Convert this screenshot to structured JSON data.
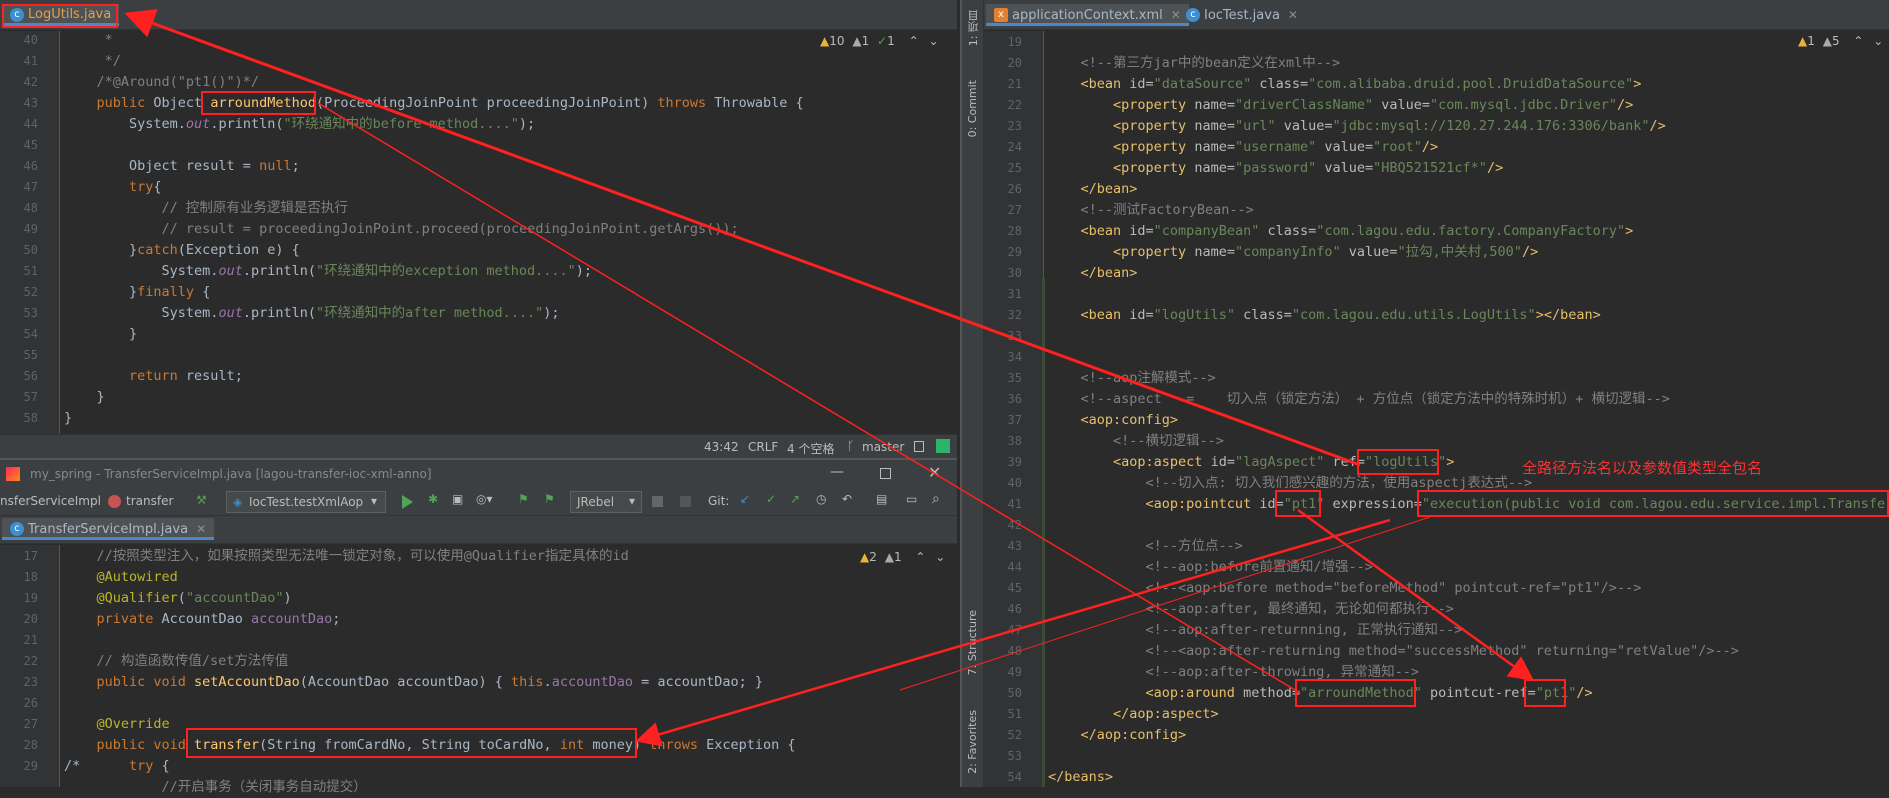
{
  "left_top": {
    "tab_label": "LogUtils.java",
    "inspection": {
      "warnings": "10",
      "weak": "1",
      "ok": "1"
    },
    "lines": [
      {
        "n": "40",
        "t": [
          [
            "cm",
            "     *"
          ]
        ]
      },
      {
        "n": "41",
        "t": [
          [
            "cm",
            "     */"
          ]
        ]
      },
      {
        "n": "42",
        "t": [
          [
            "cm",
            "    /*@Around(\"pt1()\")*/"
          ]
        ]
      },
      {
        "n": "43",
        "t": [
          [
            "kw",
            "    public "
          ],
          [
            "plain",
            "Object "
          ],
          [
            "fn",
            "arroundMethod"
          ],
          [
            "plain",
            "(ProceedingJoinPoint proceedingJoinPoint) "
          ],
          [
            "kw",
            "throws "
          ],
          [
            "plain",
            "Throwable {"
          ]
        ]
      },
      {
        "n": "44",
        "t": [
          [
            "plain",
            "        System."
          ],
          [
            "it",
            "out"
          ],
          [
            "plain",
            ".println("
          ],
          [
            "str",
            "\"环绕通知中的before method....\""
          ],
          [
            "plain",
            ");"
          ]
        ]
      },
      {
        "n": "45",
        "t": [
          [
            "plain",
            ""
          ]
        ]
      },
      {
        "n": "46",
        "t": [
          [
            "plain",
            "        Object result = "
          ],
          [
            "kw",
            "null"
          ],
          [
            "plain",
            ";"
          ]
        ]
      },
      {
        "n": "47",
        "t": [
          [
            "kw",
            "        try"
          ],
          [
            "plain",
            "{"
          ]
        ]
      },
      {
        "n": "48",
        "t": [
          [
            "cm",
            "            // 控制原有业务逻辑是否执行"
          ]
        ]
      },
      {
        "n": "49",
        "t": [
          [
            "cm",
            "            // result = proceedingJoinPoint.proceed(proceedingJoinPoint.getArgs());"
          ]
        ]
      },
      {
        "n": "50",
        "t": [
          [
            "plain",
            "        }"
          ],
          [
            "kw",
            "catch"
          ],
          [
            "plain",
            "(Exception e) {"
          ]
        ]
      },
      {
        "n": "51",
        "t": [
          [
            "plain",
            "            System."
          ],
          [
            "it",
            "out"
          ],
          [
            "plain",
            ".println("
          ],
          [
            "str",
            "\"环绕通知中的exception method....\""
          ],
          [
            "plain",
            ");"
          ]
        ]
      },
      {
        "n": "52",
        "t": [
          [
            "plain",
            "        }"
          ],
          [
            "kw",
            "finally "
          ],
          [
            "plain",
            "{"
          ]
        ]
      },
      {
        "n": "53",
        "t": [
          [
            "plain",
            "            System."
          ],
          [
            "it",
            "out"
          ],
          [
            "plain",
            ".println("
          ],
          [
            "str",
            "\"环绕通知中的after method....\""
          ],
          [
            "plain",
            ");"
          ]
        ]
      },
      {
        "n": "54",
        "t": [
          [
            "plain",
            "        }"
          ]
        ]
      },
      {
        "n": "55",
        "t": [
          [
            "plain",
            ""
          ]
        ]
      },
      {
        "n": "56",
        "t": [
          [
            "kw",
            "        return "
          ],
          [
            "plain",
            "result;"
          ]
        ]
      },
      {
        "n": "57",
        "t": [
          [
            "plain",
            "    }"
          ]
        ]
      },
      {
        "n": "58",
        "t": [
          [
            "plain",
            "}"
          ]
        ]
      }
    ],
    "status": {
      "pos": "43:42",
      "eol": "CRLF",
      "indent": "4 个空格",
      "branch": "master"
    }
  },
  "left_bottom": {
    "window_title": "my_spring - TransferServiceImpl.java [lagou-transfer-ioc-xml-anno]",
    "nav_class": "nsferServiceImpl",
    "nav_method": "transfer",
    "run_config": "IocTest.testXmlAop",
    "jrebel": "JRebel",
    "git_label": "Git:",
    "tab_label": "TransferServiceImpl.java",
    "inspection": {
      "warnings": "2",
      "weak": "1"
    },
    "lines": [
      {
        "n": "17",
        "t": [
          [
            "cm",
            "    //按照类型注入，如果按照类型无法唯一锁定对象，可以使用@Qualifier指定具体的id"
          ]
        ]
      },
      {
        "n": "18",
        "t": [
          [
            "an",
            "    @Autowired"
          ]
        ]
      },
      {
        "n": "19",
        "t": [
          [
            "an",
            "    @Qualifier"
          ],
          [
            "plain",
            "("
          ],
          [
            "str",
            "\"accountDao\""
          ],
          [
            "plain",
            ")"
          ]
        ]
      },
      {
        "n": "20",
        "t": [
          [
            "kw",
            "    private "
          ],
          [
            "plain",
            "AccountDao "
          ],
          [
            "fld",
            "accountDao"
          ],
          [
            "plain",
            ";"
          ]
        ]
      },
      {
        "n": "21",
        "t": [
          [
            "plain",
            ""
          ]
        ]
      },
      {
        "n": "22",
        "t": [
          [
            "cm",
            "    // 构造函数传值/set方法传值"
          ]
        ]
      },
      {
        "n": "23",
        "t": [
          [
            "kw",
            "    public void "
          ],
          [
            "fn",
            "setAccountDao"
          ],
          [
            "plain",
            "(AccountDao accountDao) { "
          ],
          [
            "kw",
            "this"
          ],
          [
            "plain",
            "."
          ],
          [
            "fld",
            "accountDao"
          ],
          [
            "plain",
            " = accountDao; }"
          ]
        ]
      },
      {
        "n": "26",
        "t": [
          [
            "plain",
            ""
          ]
        ]
      },
      {
        "n": "27",
        "t": [
          [
            "an",
            "    @Override"
          ]
        ]
      },
      {
        "n": "28",
        "t": [
          [
            "kw",
            "    public void "
          ],
          [
            "fn",
            "transfer"
          ],
          [
            "plain",
            "(String fromCardNo, String toCardNo, "
          ],
          [
            "kw",
            "int "
          ],
          [
            "plain",
            "money) "
          ],
          [
            "kw",
            "throws "
          ],
          [
            "plain",
            "Exception {"
          ]
        ]
      },
      {
        "n": "29",
        "t": [
          [
            "plain",
            "/*      "
          ],
          [
            "kw",
            "try "
          ],
          [
            "plain",
            "{"
          ]
        ]
      },
      {
        "n": "",
        "t": [
          [
            "cm",
            "            //开启事务（关闭事务自动提交）"
          ]
        ]
      }
    ]
  },
  "right": {
    "tabs": [
      "applicationContext.xml",
      "IocTest.java"
    ],
    "inspection": {
      "warnings": "1",
      "weak": "5"
    },
    "side_labels": [
      "1: 项目",
      "0: Commit",
      "7: Structure",
      "2: Favorites"
    ],
    "annotation_text": "全路径方法名以及参数值类型全包名",
    "lines": [
      {
        "n": "19",
        "t": [
          [
            "plain",
            ""
          ]
        ]
      },
      {
        "n": "20",
        "t": [
          [
            "cm",
            "    <!--第三方jar中的bean定义在xml中-->"
          ]
        ]
      },
      {
        "n": "21",
        "t": [
          [
            "tag",
            "    <bean "
          ],
          [
            "at",
            "id="
          ],
          [
            "str",
            "\"dataSource\" "
          ],
          [
            "at",
            "class="
          ],
          [
            "str",
            "\"com.alibaba.druid.pool.DruidDataSource\""
          ],
          [
            "tag",
            ">"
          ]
        ]
      },
      {
        "n": "22",
        "t": [
          [
            "tag",
            "        <property "
          ],
          [
            "at",
            "name="
          ],
          [
            "str",
            "\"driverClassName\" "
          ],
          [
            "at",
            "value="
          ],
          [
            "str",
            "\"com.mysql.jdbc.Driver\""
          ],
          [
            "tag",
            "/>"
          ]
        ]
      },
      {
        "n": "23",
        "t": [
          [
            "tag",
            "        <property "
          ],
          [
            "at",
            "name="
          ],
          [
            "str",
            "\"url\" "
          ],
          [
            "at",
            "value="
          ],
          [
            "str",
            "\"jdbc:mysql://120.27.244.176:3306/bank\""
          ],
          [
            "tag",
            "/>"
          ]
        ]
      },
      {
        "n": "24",
        "t": [
          [
            "tag",
            "        <property "
          ],
          [
            "at",
            "name="
          ],
          [
            "str",
            "\"username\" "
          ],
          [
            "at",
            "value="
          ],
          [
            "str",
            "\"root\""
          ],
          [
            "tag",
            "/>"
          ]
        ]
      },
      {
        "n": "25",
        "t": [
          [
            "tag",
            "        <property "
          ],
          [
            "at",
            "name="
          ],
          [
            "str",
            "\"password\" "
          ],
          [
            "at",
            "value="
          ],
          [
            "str",
            "\"HBQ521521cf*\""
          ],
          [
            "tag",
            "/>"
          ]
        ]
      },
      {
        "n": "26",
        "t": [
          [
            "tag",
            "    </bean>"
          ]
        ]
      },
      {
        "n": "27",
        "t": [
          [
            "cm",
            "    <!--测试FactoryBean-->"
          ]
        ]
      },
      {
        "n": "28",
        "t": [
          [
            "tag",
            "    <bean "
          ],
          [
            "at",
            "id="
          ],
          [
            "str",
            "\"companyBean\" "
          ],
          [
            "at",
            "class="
          ],
          [
            "str",
            "\"com.lagou.edu.factory.CompanyFactory\""
          ],
          [
            "tag",
            ">"
          ]
        ]
      },
      {
        "n": "29",
        "t": [
          [
            "tag",
            "        <property "
          ],
          [
            "at",
            "name="
          ],
          [
            "str",
            "\"companyInfo\" "
          ],
          [
            "at",
            "value="
          ],
          [
            "str",
            "\"拉勾,中关村,500\""
          ],
          [
            "tag",
            "/>"
          ]
        ]
      },
      {
        "n": "30",
        "t": [
          [
            "tag",
            "    </bean>"
          ]
        ]
      },
      {
        "n": "31",
        "t": [
          [
            "plain",
            ""
          ]
        ]
      },
      {
        "n": "32",
        "t": [
          [
            "tag",
            "    <bean "
          ],
          [
            "at",
            "id="
          ],
          [
            "str",
            "\"logUtils\" "
          ],
          [
            "at",
            "class="
          ],
          [
            "str",
            "\"com.lagou.edu.utils.LogUtils\""
          ],
          [
            "tag",
            "></bean>"
          ]
        ]
      },
      {
        "n": "33",
        "t": [
          [
            "plain",
            ""
          ]
        ]
      },
      {
        "n": "34",
        "t": [
          [
            "plain",
            ""
          ]
        ]
      },
      {
        "n": "35",
        "t": [
          [
            "cm",
            "    <!--aop注解模式-->"
          ]
        ]
      },
      {
        "n": "36",
        "t": [
          [
            "cm",
            "    <!--aspect   =    切入点（锁定方法） + 方位点（锁定方法中的特殊时机）+ 横切逻辑-->"
          ]
        ]
      },
      {
        "n": "37",
        "t": [
          [
            "tag",
            "    <aop:config>"
          ]
        ]
      },
      {
        "n": "38",
        "t": [
          [
            "cm",
            "        <!--横切逻辑-->"
          ]
        ]
      },
      {
        "n": "39",
        "t": [
          [
            "tag",
            "        <aop:aspect "
          ],
          [
            "at",
            "id="
          ],
          [
            "str",
            "\"lagAspect\" "
          ],
          [
            "at",
            "ref="
          ],
          [
            "str",
            "\"logUtils\""
          ],
          [
            "tag",
            ">"
          ]
        ]
      },
      {
        "n": "40",
        "t": [
          [
            "cm",
            "            <!--切入点: 切入我们感兴趣的方法，使用aspectj表达式-->"
          ]
        ]
      },
      {
        "n": "41",
        "t": [
          [
            "tag",
            "            <aop:pointcut "
          ],
          [
            "at",
            "id="
          ],
          [
            "str",
            "\"pt1\" "
          ],
          [
            "at",
            "expression="
          ],
          [
            "str",
            "\"execution(public void com.lagou.edu.service.impl.TransferServiceImpl.transfer(java.lang.String,java.lang.String,int))\""
          ],
          [
            "tag",
            "/>"
          ]
        ]
      },
      {
        "n": "42",
        "t": [
          [
            "plain",
            ""
          ]
        ]
      },
      {
        "n": "43",
        "t": [
          [
            "cm",
            "            <!--方位点-->"
          ]
        ]
      },
      {
        "n": "44",
        "t": [
          [
            "cm",
            "            <!--aop:before前置通知/增强-->"
          ]
        ]
      },
      {
        "n": "45",
        "t": [
          [
            "cm",
            "            <!--<aop:before method=\"beforeMethod\" pointcut-ref=\"pt1\"/>-->"
          ]
        ]
      },
      {
        "n": "46",
        "t": [
          [
            "cm",
            "            <!--aop:after, 最终通知，无论如何都执行-->"
          ]
        ]
      },
      {
        "n": "47",
        "t": [
          [
            "cm",
            "            <!--aop:after-returnning, 正常执行通知-->"
          ]
        ]
      },
      {
        "n": "48",
        "t": [
          [
            "cm",
            "            <!--<aop:after-returning method=\"successMethod\" returning=\"retValue\"/>-->"
          ]
        ]
      },
      {
        "n": "49",
        "t": [
          [
            "cm",
            "            <!--aop:after-throwing, 异常通知-->"
          ]
        ]
      },
      {
        "n": "50",
        "t": [
          [
            "tag",
            "            <aop:around "
          ],
          [
            "at",
            "method="
          ],
          [
            "str",
            "\"arroundMethod\" "
          ],
          [
            "at",
            "pointcut-ref="
          ],
          [
            "str",
            "\"pt1\""
          ],
          [
            "tag",
            "/>"
          ]
        ]
      },
      {
        "n": "51",
        "t": [
          [
            "tag",
            "        </aop:aspect>"
          ]
        ]
      },
      {
        "n": "52",
        "t": [
          [
            "tag",
            "    </aop:config>"
          ]
        ]
      },
      {
        "n": "53",
        "t": [
          [
            "plain",
            ""
          ]
        ]
      },
      {
        "n": "54",
        "t": [
          [
            "tag",
            "</beans>"
          ]
        ]
      }
    ]
  },
  "colors": {
    "annotation_red": "#ff2020",
    "editor_bg": "#2b2b2b",
    "panel_bg": "#3c3f41"
  }
}
